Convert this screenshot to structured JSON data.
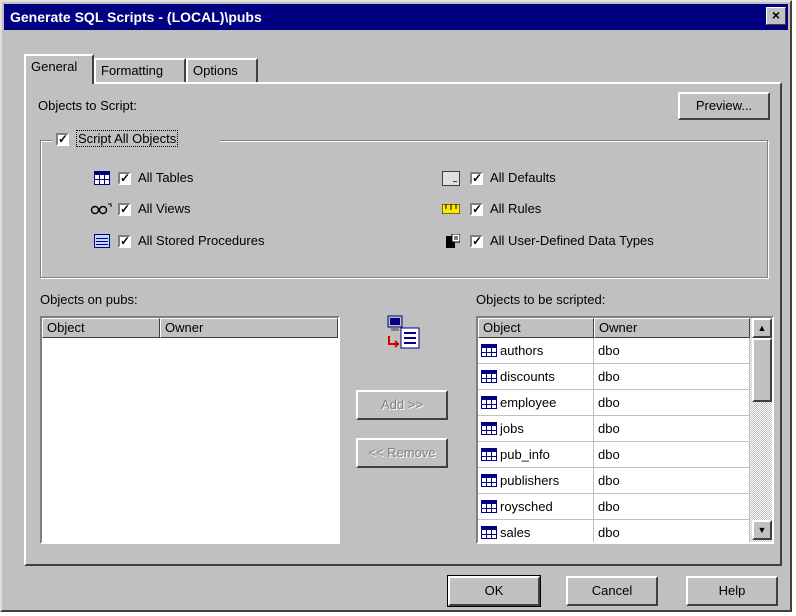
{
  "window": {
    "title": "Generate SQL Scripts - (LOCAL)\\pubs",
    "close_label": "×"
  },
  "tabs": [
    {
      "label": "General"
    },
    {
      "label": "Formatting"
    },
    {
      "label": "Options"
    }
  ],
  "general": {
    "objects_to_script_label": "Objects to Script:",
    "preview_label": "Preview...",
    "script_all_label": "Script All Objects",
    "checks": {
      "all_tables": "All Tables",
      "all_views": "All Views",
      "all_stored_procedures": "All Stored Procedures",
      "all_defaults": "All Defaults",
      "all_rules": "All Rules",
      "all_udt": "All User-Defined Data Types"
    },
    "check_mark": "✓",
    "objects_on_label": "Objects on pubs:",
    "objects_to_be_scripted_label": "Objects to be scripted:",
    "columns": {
      "object": "Object",
      "owner": "Owner"
    },
    "add_label": "Add >>",
    "remove_label": "<< Remove",
    "scripted": [
      {
        "object": "authors",
        "owner": "dbo"
      },
      {
        "object": "discounts",
        "owner": "dbo"
      },
      {
        "object": "employee",
        "owner": "dbo"
      },
      {
        "object": "jobs",
        "owner": "dbo"
      },
      {
        "object": "pub_info",
        "owner": "dbo"
      },
      {
        "object": "publishers",
        "owner": "dbo"
      },
      {
        "object": "roysched",
        "owner": "dbo"
      },
      {
        "object": "sales",
        "owner": "dbo"
      }
    ]
  },
  "footer": {
    "ok": "OK",
    "cancel": "Cancel",
    "help": "Help"
  }
}
